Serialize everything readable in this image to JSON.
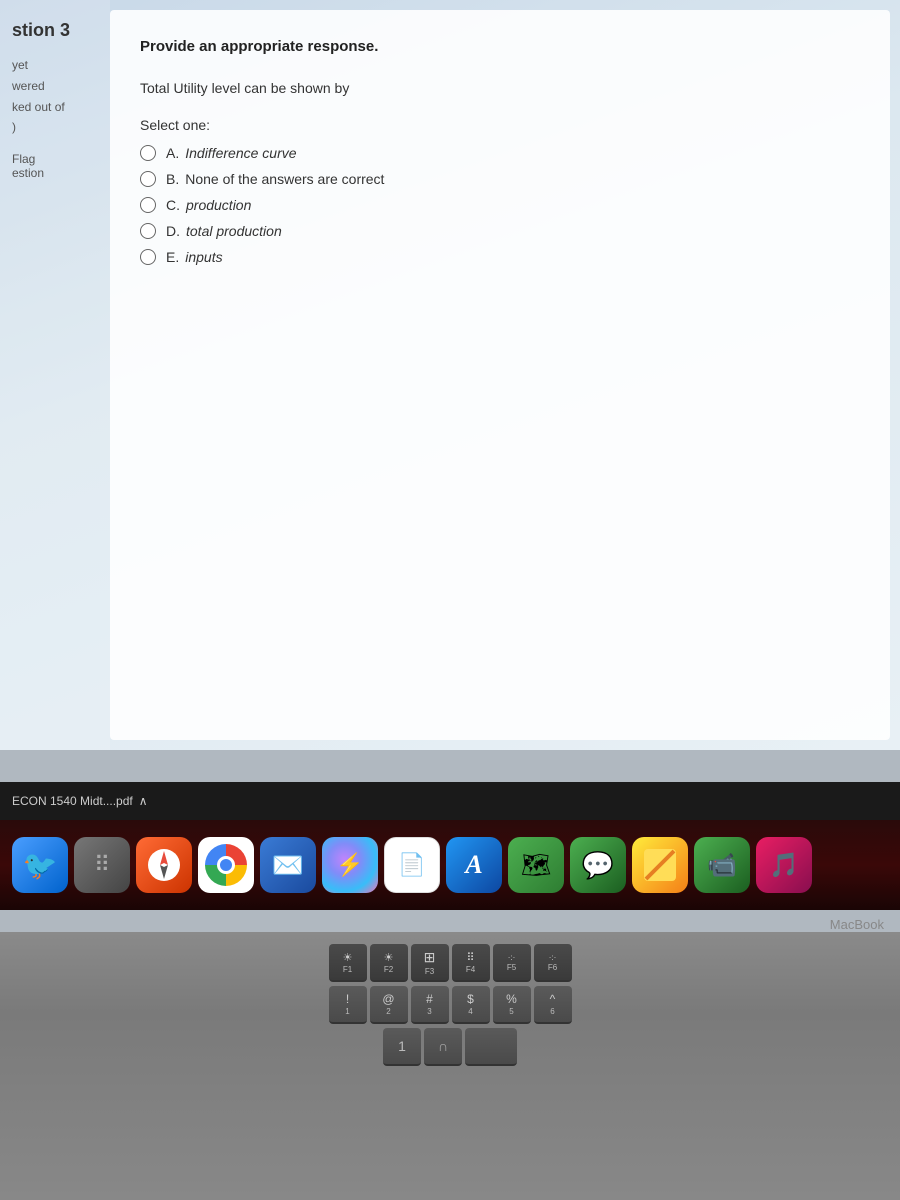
{
  "sidebar": {
    "question_num": "stion 3",
    "status_not_yet": "yet",
    "status_answered": "wered",
    "marked_out": "ked out of",
    "marked_val": ")",
    "flag": "Flag",
    "question": "estion"
  },
  "question": {
    "instruction": "Provide an appropriate response.",
    "text": "Total Utility level can be shown by",
    "select_label": "Select one:",
    "options": [
      {
        "letter": "A.",
        "text": "Indifference curve",
        "italic": true
      },
      {
        "letter": "B.",
        "text": "None of the answers are correct",
        "italic": false
      },
      {
        "letter": "C.",
        "text": "production",
        "italic": true
      },
      {
        "letter": "D.",
        "text": "total production",
        "italic": true
      },
      {
        "letter": "E.",
        "text": "inputs",
        "italic": true
      }
    ]
  },
  "taskbar": {
    "label": "ECON 1540 Midt....pdf",
    "chevron": "∧"
  },
  "macbook": {
    "label": "MacBook"
  },
  "dock": {
    "icons": [
      {
        "id": "finder",
        "emoji": "🐦",
        "css_class": "dock-finder"
      },
      {
        "id": "launchpad",
        "emoji": "⠿",
        "css_class": "dock-launchpad"
      },
      {
        "id": "compass",
        "emoji": "🧭",
        "css_class": "dock-compass"
      },
      {
        "id": "chrome",
        "emoji": "chrome",
        "css_class": "dock-chrome"
      },
      {
        "id": "mail",
        "emoji": "✉️",
        "css_class": "dock-mail"
      },
      {
        "id": "siri",
        "emoji": "◐",
        "css_class": "dock-siri"
      },
      {
        "id": "blank",
        "emoji": " ",
        "css_class": "dock-white"
      },
      {
        "id": "appstore",
        "emoji": "A",
        "css_class": "dock-appstore"
      },
      {
        "id": "maps",
        "emoji": "🗺",
        "css_class": "dock-maps"
      },
      {
        "id": "messages",
        "emoji": "💬",
        "css_class": "dock-messages"
      },
      {
        "id": "notes",
        "emoji": "📝",
        "css_class": "dock-notes"
      },
      {
        "id": "facetime",
        "emoji": "📹",
        "css_class": "dock-facetime"
      },
      {
        "id": "music",
        "emoji": "🎵",
        "css_class": "dock-music"
      }
    ]
  },
  "keyboard": {
    "row1": [
      {
        "label": "F1",
        "icon": "☀"
      },
      {
        "label": "F2",
        "icon": "☀"
      },
      {
        "label": "F3",
        "icon": "⊞"
      },
      {
        "label": "F4",
        "icon": "⠿"
      },
      {
        "label": "F5",
        "icon": "·:·"
      },
      {
        "label": "F6",
        "icon": "·:·"
      }
    ],
    "row2": [
      {
        "label": "!",
        "top": ""
      },
      {
        "label": "1",
        "top": ""
      },
      {
        "label": "@",
        "top": ""
      },
      {
        "label": "2",
        "top": ""
      },
      {
        "label": "#",
        "top": ""
      },
      {
        "label": "$",
        "top": ""
      },
      {
        "label": "%",
        "top": ""
      },
      {
        "label": "^",
        "top": ""
      }
    ]
  }
}
